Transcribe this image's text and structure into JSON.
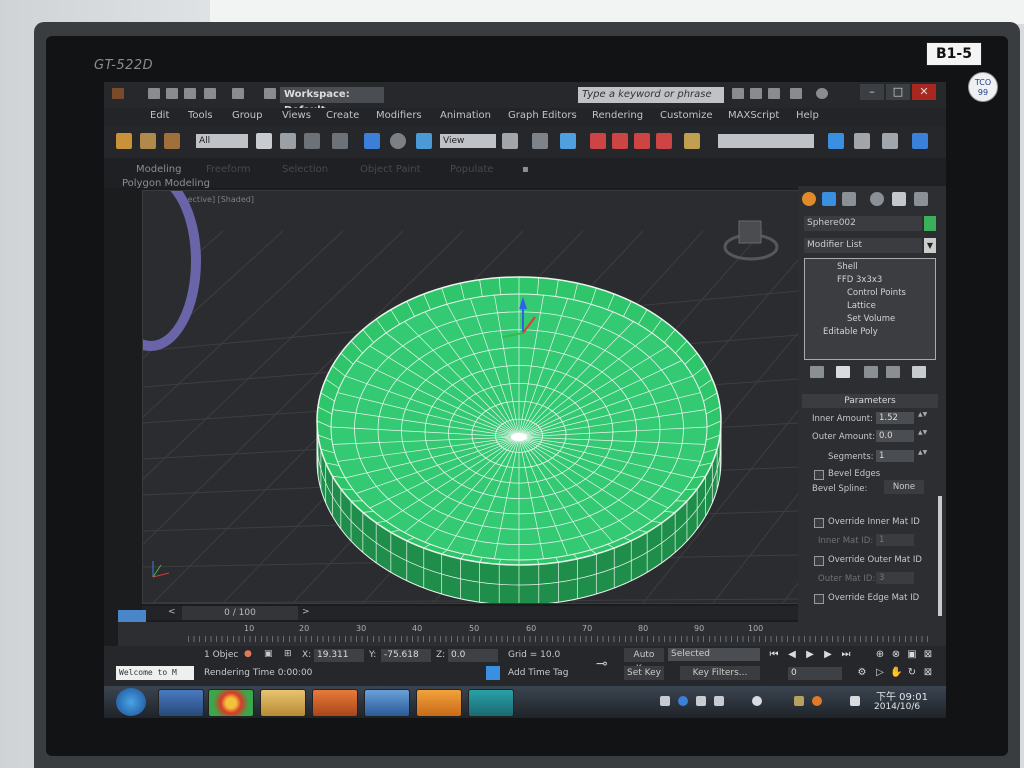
{
  "monitor": {
    "brand": "GT-522D",
    "asset_tag": "B1-5",
    "tco_label": "TCO 99"
  },
  "app": {
    "workspace": "Workspace: Default",
    "search_placeholder": "Type a keyword or phrase",
    "menu": [
      "Edit",
      "Tools",
      "Group",
      "Views",
      "Create",
      "Modifiers",
      "Animation",
      "Graph Editors",
      "Rendering",
      "Customize",
      "MAXScript",
      "Help"
    ],
    "toolbar": {
      "filter_value": "All",
      "coord_value": "View"
    },
    "ribbon": {
      "tabs": [
        "Modeling",
        "Freeform",
        "Selection",
        "Object Paint",
        "Populate"
      ],
      "panel_label": "Polygon Modeling"
    }
  },
  "viewport": {
    "label": "[+] [Perspective] [Shaded]"
  },
  "command_panel": {
    "object_name": "Sphere002",
    "modifier_list_label": "Modifier List",
    "object_color": "#3bb05a",
    "stack": [
      {
        "label": "Shell",
        "level": 0,
        "selected": true
      },
      {
        "label": "FFD 3x3x3",
        "level": 0,
        "selected": false
      },
      {
        "label": "Control Points",
        "level": 1,
        "selected": false
      },
      {
        "label": "Lattice",
        "level": 1,
        "selected": false
      },
      {
        "label": "Set Volume",
        "level": 1,
        "selected": false
      },
      {
        "label": "Editable Poly",
        "level": 0,
        "selected": false
      }
    ],
    "parameters": {
      "title": "Parameters",
      "inner_amount_label": "Inner Amount:",
      "inner_amount": "1.52",
      "outer_amount_label": "Outer Amount:",
      "outer_amount": "0.0",
      "segments_label": "Segments:",
      "segments": "1",
      "bevel_edges_label": "Bevel Edges",
      "bevel_spline_label": "Bevel Spline:",
      "bevel_spline_value": "None",
      "override_inner_label": "Override Inner Mat ID",
      "inner_mat_id_label": "Inner Mat ID:",
      "inner_mat_id": "1",
      "override_outer_label": "Override Outer Mat ID",
      "outer_mat_id_label": "Outer Mat ID:",
      "outer_mat_id": "3",
      "override_edge_label": "Override Edge Mat ID"
    }
  },
  "timeline": {
    "frame_label": "0 / 100",
    "ticks": [
      "10",
      "20",
      "30",
      "40",
      "50",
      "60",
      "70",
      "80",
      "90",
      "100"
    ]
  },
  "status": {
    "welcome": "Welcome to M",
    "selection": "1 Objec",
    "x_label": "X:",
    "x_value": "19.311",
    "y_label": "Y:",
    "y_value": "-75.618",
    "z_label": "Z:",
    "z_value": "0.0",
    "grid": "Grid = 10.0",
    "rendering_time": "Rendering Time  0:00:00",
    "add_time_tag": "Add Time Tag",
    "auto_key": "Auto Key",
    "set_key": "Set Key",
    "selected_value": "Selected",
    "key_filters": "Key Filters...",
    "frame_field": "0"
  },
  "taskbar": {
    "time": "下午 09:01",
    "date": "2014/10/6"
  },
  "colors": {
    "mesh_fill": "#2fc56a",
    "mesh_wire": "#e8f5ec",
    "viewport_bg": "#2b2c2f"
  }
}
